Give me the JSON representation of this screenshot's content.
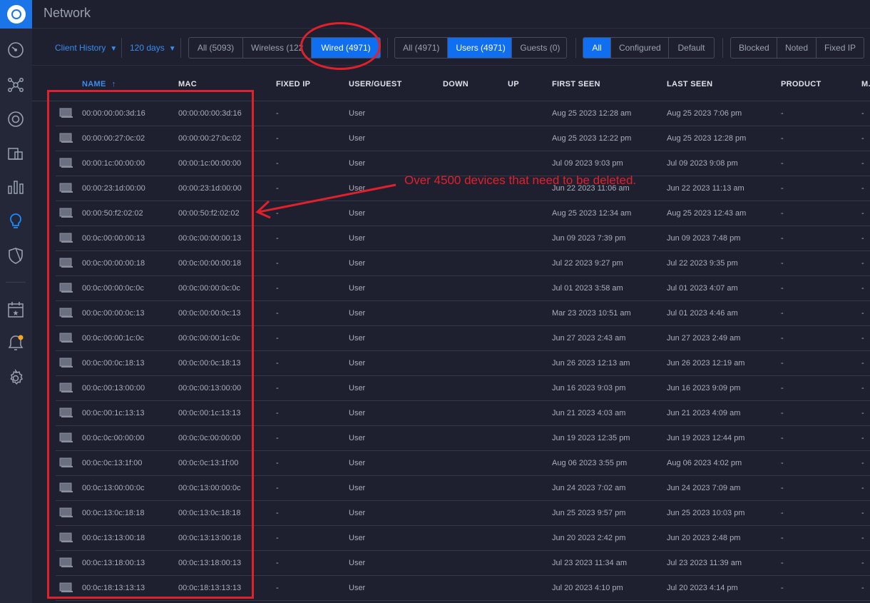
{
  "header": {
    "title": "Network"
  },
  "toolbar": {
    "history_dropdown": "Client History",
    "days_dropdown": "120 days",
    "conn_filter": [
      "All (5093)",
      "Wireless (122",
      "Wired (4971)"
    ],
    "conn_active": 2,
    "user_filter": [
      "All (4971)",
      "Users (4971)",
      "Guests (0)"
    ],
    "user_active": 1,
    "config_filter": [
      "All",
      "Configured",
      "Default"
    ],
    "config_active": 0,
    "flag_filter": [
      "Blocked",
      "Noted",
      "Fixed IP"
    ]
  },
  "annotation": {
    "note": "Over 4500 devices that need to be deleted."
  },
  "table": {
    "columns": [
      "NAME",
      "MAC",
      "FIXED IP",
      "USER/GUEST",
      "DOWN",
      "UP",
      "FIRST SEEN",
      "LAST SEEN",
      "PRODUCT",
      "M."
    ],
    "sort_indicator": "↑",
    "rows": [
      {
        "name": "00:00:00:00:3d:16",
        "mac": "00:00:00:00:3d:16",
        "fixed_ip": "-",
        "type": "User",
        "down": "",
        "up": "",
        "first": "Aug 25 2023 12:28 am",
        "last": "Aug 25 2023 7:06 pm",
        "product": "-",
        "m": "-"
      },
      {
        "name": "00:00:00:27:0c:02",
        "mac": "00:00:00:27:0c:02",
        "fixed_ip": "-",
        "type": "User",
        "down": "",
        "up": "",
        "first": "Aug 25 2023 12:22 pm",
        "last": "Aug 25 2023 12:28 pm",
        "product": "-",
        "m": "-"
      },
      {
        "name": "00:00:1c:00:00:00",
        "mac": "00:00:1c:00:00:00",
        "fixed_ip": "-",
        "type": "User",
        "down": "",
        "up": "",
        "first": "Jul 09 2023 9:03 pm",
        "last": "Jul 09 2023 9:08 pm",
        "product": "-",
        "m": "-"
      },
      {
        "name": "00:00:23:1d:00:00",
        "mac": "00:00:23:1d:00:00",
        "fixed_ip": "-",
        "type": "User",
        "down": "",
        "up": "",
        "first": "Jun 22 2023 11:06 am",
        "last": "Jun 22 2023 11:13 am",
        "product": "-",
        "m": "-"
      },
      {
        "name": "00:00:50:f2:02:02",
        "mac": "00:00:50:f2:02:02",
        "fixed_ip": "-",
        "type": "User",
        "down": "",
        "up": "",
        "first": "Aug 25 2023 12:34 am",
        "last": "Aug 25 2023 12:43 am",
        "product": "-",
        "m": "-"
      },
      {
        "name": "00:0c:00:00:00:13",
        "mac": "00:0c:00:00:00:13",
        "fixed_ip": "-",
        "type": "User",
        "down": "",
        "up": "",
        "first": "Jun 09 2023 7:39 pm",
        "last": "Jun 09 2023 7:48 pm",
        "product": "-",
        "m": "-"
      },
      {
        "name": "00:0c:00:00:00:18",
        "mac": "00:0c:00:00:00:18",
        "fixed_ip": "-",
        "type": "User",
        "down": "",
        "up": "",
        "first": "Jul 22 2023 9:27 pm",
        "last": "Jul 22 2023 9:35 pm",
        "product": "-",
        "m": "-"
      },
      {
        "name": "00:0c:00:00:0c:0c",
        "mac": "00:0c:00:00:0c:0c",
        "fixed_ip": "-",
        "type": "User",
        "down": "",
        "up": "",
        "first": "Jul 01 2023 3:58 am",
        "last": "Jul 01 2023 4:07 am",
        "product": "-",
        "m": "-"
      },
      {
        "name": "00:0c:00:00:0c:13",
        "mac": "00:0c:00:00:0c:13",
        "fixed_ip": "-",
        "type": "User",
        "down": "",
        "up": "",
        "first": "Mar 23 2023 10:51 am",
        "last": "Jul 01 2023 4:46 am",
        "product": "-",
        "m": "-"
      },
      {
        "name": "00:0c:00:00:1c:0c",
        "mac": "00:0c:00:00:1c:0c",
        "fixed_ip": "-",
        "type": "User",
        "down": "",
        "up": "",
        "first": "Jun 27 2023 2:43 am",
        "last": "Jun 27 2023 2:49 am",
        "product": "-",
        "m": "-"
      },
      {
        "name": "00:0c:00:0c:18:13",
        "mac": "00:0c:00:0c:18:13",
        "fixed_ip": "-",
        "type": "User",
        "down": "",
        "up": "",
        "first": "Jun 26 2023 12:13 am",
        "last": "Jun 26 2023 12:19 am",
        "product": "-",
        "m": "-"
      },
      {
        "name": "00:0c:00:13:00:00",
        "mac": "00:0c:00:13:00:00",
        "fixed_ip": "-",
        "type": "User",
        "down": "",
        "up": "",
        "first": "Jun 16 2023 9:03 pm",
        "last": "Jun 16 2023 9:09 pm",
        "product": "-",
        "m": "-"
      },
      {
        "name": "00:0c:00:1c:13:13",
        "mac": "00:0c:00:1c:13:13",
        "fixed_ip": "-",
        "type": "User",
        "down": "",
        "up": "",
        "first": "Jun 21 2023 4:03 am",
        "last": "Jun 21 2023 4:09 am",
        "product": "-",
        "m": "-"
      },
      {
        "name": "00:0c:0c:00:00:00",
        "mac": "00:0c:0c:00:00:00",
        "fixed_ip": "-",
        "type": "User",
        "down": "",
        "up": "",
        "first": "Jun 19 2023 12:35 pm",
        "last": "Jun 19 2023 12:44 pm",
        "product": "-",
        "m": "-"
      },
      {
        "name": "00:0c:0c:13:1f:00",
        "mac": "00:0c:0c:13:1f:00",
        "fixed_ip": "-",
        "type": "User",
        "down": "",
        "up": "",
        "first": "Aug 06 2023 3:55 pm",
        "last": "Aug 06 2023 4:02 pm",
        "product": "-",
        "m": "-"
      },
      {
        "name": "00:0c:13:00:00:0c",
        "mac": "00:0c:13:00:00:0c",
        "fixed_ip": "-",
        "type": "User",
        "down": "",
        "up": "",
        "first": "Jun 24 2023 7:02 am",
        "last": "Jun 24 2023 7:09 am",
        "product": "-",
        "m": "-"
      },
      {
        "name": "00:0c:13:0c:18:18",
        "mac": "00:0c:13:0c:18:18",
        "fixed_ip": "-",
        "type": "User",
        "down": "",
        "up": "",
        "first": "Jun 25 2023 9:57 pm",
        "last": "Jun 25 2023 10:03 pm",
        "product": "-",
        "m": "-"
      },
      {
        "name": "00:0c:13:13:00:18",
        "mac": "00:0c:13:13:00:18",
        "fixed_ip": "-",
        "type": "User",
        "down": "",
        "up": "",
        "first": "Jun 20 2023 2:42 pm",
        "last": "Jun 20 2023 2:48 pm",
        "product": "-",
        "m": "-"
      },
      {
        "name": "00:0c:13:18:00:13",
        "mac": "00:0c:13:18:00:13",
        "fixed_ip": "-",
        "type": "User",
        "down": "",
        "up": "",
        "first": "Jul 23 2023 11:34 am",
        "last": "Jul 23 2023 11:39 am",
        "product": "-",
        "m": "-"
      },
      {
        "name": "00:0c:18:13:13:13",
        "mac": "00:0c:18:13:13:13",
        "fixed_ip": "-",
        "type": "User",
        "down": "",
        "up": "",
        "first": "Jul 20 2023 4:10 pm",
        "last": "Jul 20 2023 4:14 pm",
        "product": "-",
        "m": "-"
      }
    ]
  },
  "colors": {
    "accent": "#0f6ff0",
    "annotation": "#e0212b",
    "background": "#1e2030",
    "notification_dot": "#f5a623"
  },
  "sidebar": {
    "icons": [
      "dashboard-icon",
      "topology-icon",
      "devices-icon",
      "clients-icon",
      "statistics-icon",
      "insights-icon",
      "shield-icon",
      "events-icon",
      "alerts-icon",
      "settings-icon"
    ],
    "active": "insights-icon"
  }
}
